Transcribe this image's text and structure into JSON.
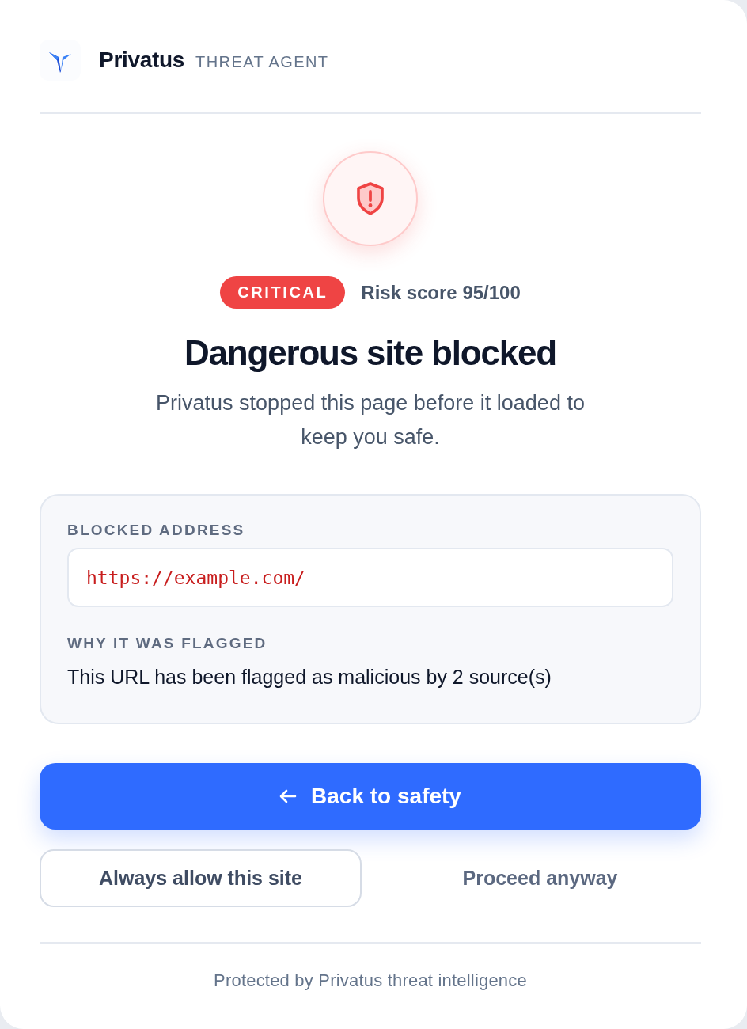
{
  "header": {
    "brand": "Privatus",
    "product": "THREAT AGENT"
  },
  "alert": {
    "badge": "CRITICAL",
    "risk_score": "Risk score 95/100",
    "title": "Dangerous site blocked",
    "message": "Privatus stopped this page before it loaded to keep you safe."
  },
  "details": {
    "blocked_address_label": "BLOCKED ADDRESS",
    "blocked_address": "https://example.com/",
    "reason_label": "WHY IT WAS FLAGGED",
    "reason": "This URL has been flagged as malicious by 2 source(s)"
  },
  "actions": [
    {
      "kind": "primary",
      "label": "Back to safety"
    },
    {
      "kind": "outline",
      "label": "Always allow this site"
    },
    {
      "kind": "text",
      "label": "Proceed anyway"
    }
  ],
  "footer": "Protected by Privatus threat intelligence"
}
